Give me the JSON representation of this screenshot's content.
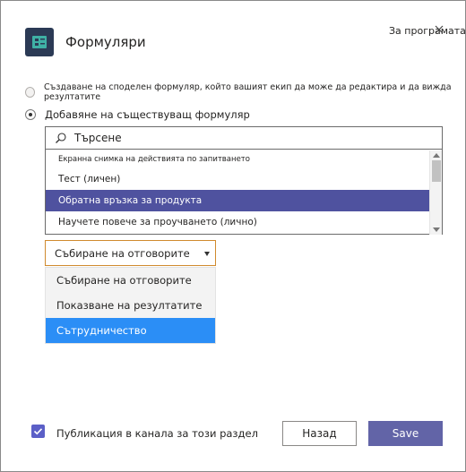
{
  "header": {
    "app_title": "Формуляри",
    "about_link": "За програмата",
    "icon_color": "#2b3a55"
  },
  "options": {
    "create_shared": "Създаване на споделен формуляр, който вашият екип да може да редактира и да вижда резултатите",
    "add_existing": "Добавяне на съществуващ формуляр"
  },
  "search": {
    "value": "Търсене"
  },
  "forms_list": [
    "Екранна снимка на действията по запитването",
    "Тест (личен)",
    "Обратна връзка за продукта",
    "Научете повече за проучването (лично)"
  ],
  "forms_selected_index": 2,
  "mode_select": {
    "selected": "Събиране на отговорите",
    "options": [
      "Събиране на отговорите",
      "Показване на резултатите",
      "Сътрудничество"
    ],
    "highlighted_index": 2
  },
  "footer": {
    "publish_label": "Публикация в канала за този раздел",
    "back_label": "Назад",
    "save_label": "Save"
  },
  "colors": {
    "accent": "#6264a7",
    "selected_row": "#4f529f",
    "highlight_option": "#2b8ef6",
    "dropdown_border": "#d08a2e"
  }
}
